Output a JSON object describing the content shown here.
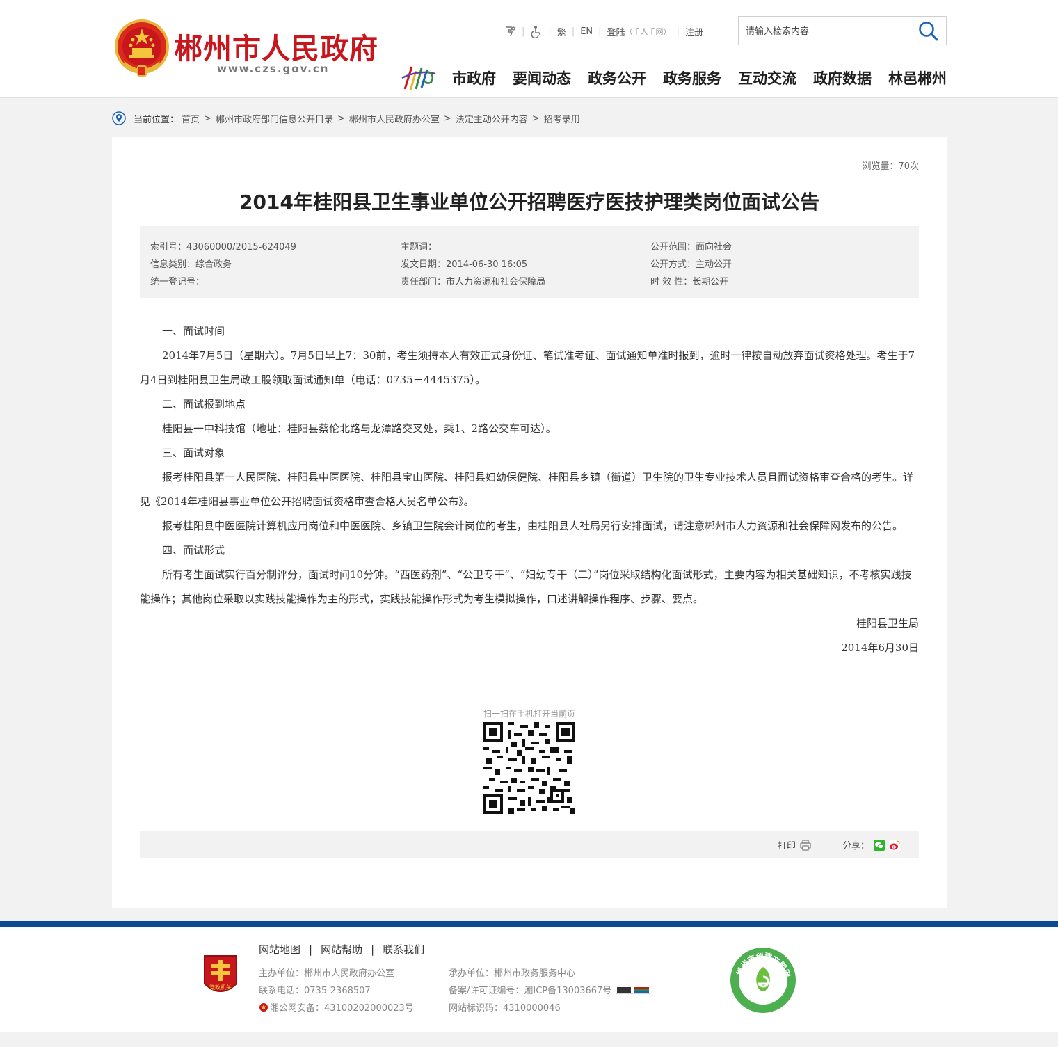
{
  "header": {
    "site_title": "郴州市人民政府",
    "site_url": "www.czs.gov.cn",
    "top_links": {
      "traditional": "繁",
      "english": "EN",
      "login": "登陆",
      "login_sub": "（千人千网）",
      "register": "注册"
    },
    "search": {
      "placeholder": "请输入检索内容"
    },
    "nav": [
      "市政府",
      "要闻动态",
      "政务公开",
      "政务服务",
      "互动交流",
      "政府数据",
      "林邑郴州"
    ]
  },
  "breadcrumb": {
    "label": "当前位置：",
    "items": [
      "首页",
      "郴州市政府部门信息公开目录",
      "郴州市人民政府办公室",
      "法定主动公开内容",
      "招考录用"
    ]
  },
  "article": {
    "views": "浏览量：70次",
    "title": "2014年桂阳县卫生事业单位公开招聘医疗医技护理类岗位面试公告",
    "meta": {
      "index_no": "索引号：43060000/2015-624049",
      "theme": "主题词：",
      "scope": "公开范围：面向社会",
      "category": "信息类别：综合政务",
      "date": "发文日期：2014-06-30 16:05",
      "method": "公开方式：主动公开",
      "reg_no": "统一登记号：",
      "dept": "责任部门：市人力资源和社会保障局",
      "validity": "时 效 性：长期公开"
    },
    "paragraphs": [
      "一、面试时间",
      "2014年7月5日（星期六）。7月5日早上7：30前，考生须持本人有效正式身份证、笔试准考证、面试通知单准时报到，逾时一律按自动放弃面试资格处理。考生于7月4日到桂阳县卫生局政工股领取面试通知单（电话：0735－4445375）。",
      "二、面试报到地点",
      "桂阳县一中科技馆（地址：桂阳县蔡伦北路与龙潭路交叉处，乘1、2路公交车可达）。",
      "三、面试对象",
      "报考桂阳县第一人民医院、桂阳县中医医院、桂阳县宝山医院、桂阳县妇幼保健院、桂阳县乡镇（街道）卫生院的卫生专业技术人员且面试资格审查合格的考生。详见《2014年桂阳县事业单位公开招聘面试资格审查合格人员名单公布》。",
      "报考桂阳县中医医院计算机应用岗位和中医医院、乡镇卫生院会计岗位的考生，由桂阳县人社局另行安排面试，请注意郴州市人力资源和社会保障网发布的公告。",
      "四、面试形式",
      "所有考生面试实行百分制评分，面试时间10分钟。“西医药剂”、“公卫专干”、“妇幼专干（二）”岗位采取结构化面试形式，主要内容为相关基础知识，不考核实践技能操作；其他岗位采取以实践技能操作为主的形式，实践技能操作形式为考生模拟操作，口述讲解操作程序、步骤、要点。"
    ],
    "signature": "桂阳县卫生局",
    "sign_date": "2014年6月30日",
    "qr_caption": "扫一扫在手机打开当前页",
    "print_label": "打印",
    "share_label": "分享："
  },
  "footer": {
    "links": [
      "网站地图",
      "网站帮助",
      "联系我们"
    ],
    "sponsor": "主办单位：郴州市人民政府办公室",
    "organizer": "承办单位：郴州市政务服务中心",
    "phone": "联系电话：0735-2368507",
    "icp": "备案/许可证编号：湘ICP备13003667号",
    "police": "湘公网安备：43100202000023号",
    "site_id": "网站标识码：4310000046",
    "gov_badge_text": "党政机关",
    "civil_badge_text": "郴州市创建文明网站"
  },
  "colors": {
    "brand_red": "#c8161d",
    "footer_blue": "#0b4a94",
    "gold": "#e8b63a"
  }
}
